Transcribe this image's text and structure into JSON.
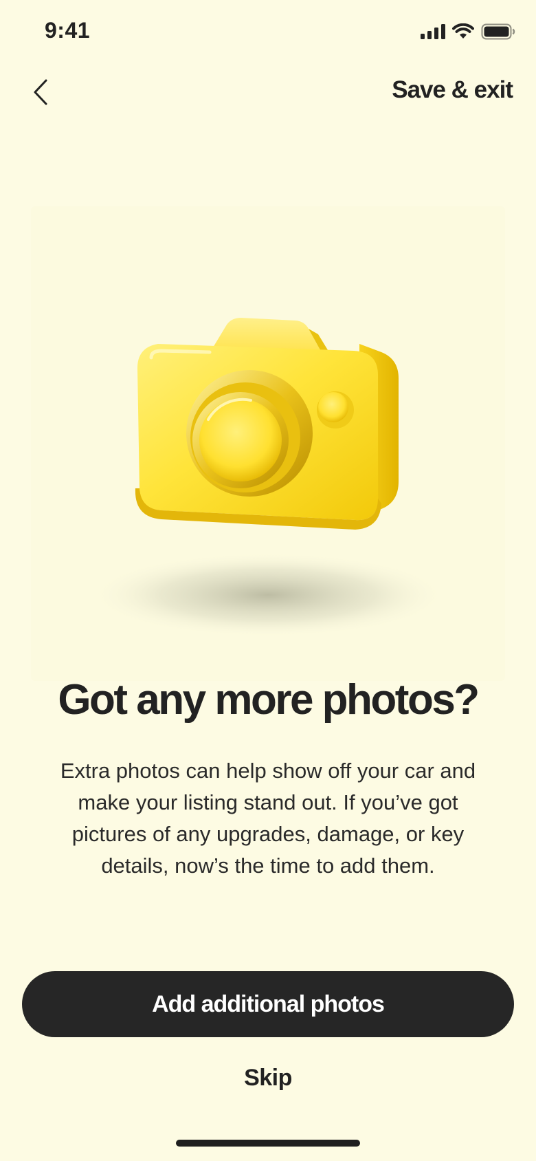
{
  "status_bar": {
    "time": "9:41",
    "icons": [
      "cellular-signal-icon",
      "wifi-icon",
      "battery-icon"
    ]
  },
  "nav": {
    "back_icon": "chevron-left-icon",
    "save_exit_label": "Save & exit"
  },
  "illustration": {
    "icon": "camera-icon",
    "accent_color": "#ffe033"
  },
  "content": {
    "headline": "Got any more photos?",
    "body": "Extra photos can help show off your car and make your listing stand out. If you’ve got pictures of any upgrades, damage, or key details, now’s the time to add them."
  },
  "actions": {
    "primary_label": "Add additional photos",
    "skip_label": "Skip"
  },
  "colors": {
    "background": "#fdfbe3",
    "button": "#262626",
    "text": "#222222"
  }
}
